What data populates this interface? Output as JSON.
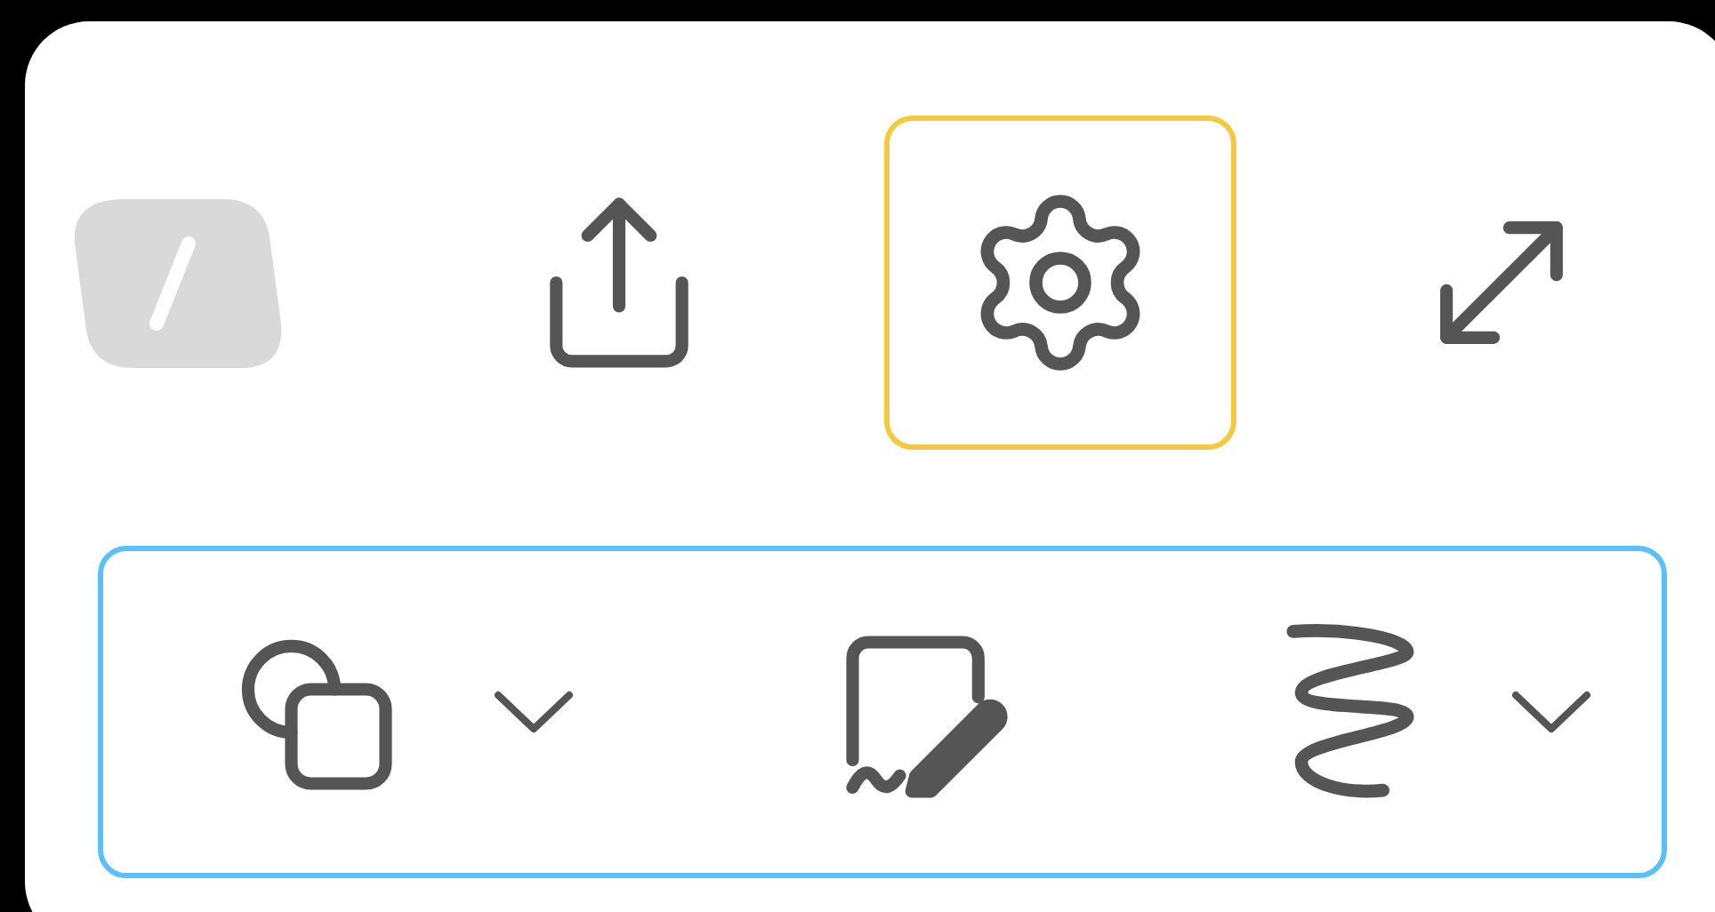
{
  "top_toolbar": [
    {
      "kind": "logo",
      "selected": false
    },
    {
      "kind": "share",
      "selected": false
    },
    {
      "kind": "settings",
      "selected": true
    },
    {
      "kind": "expand",
      "selected": false
    }
  ],
  "tool_group": {
    "focused": true,
    "items": [
      {
        "kind": "shapes",
        "dropdown": true
      },
      {
        "kind": "sticky-note",
        "dropdown": false
      },
      {
        "kind": "ink",
        "dropdown": true
      }
    ]
  }
}
